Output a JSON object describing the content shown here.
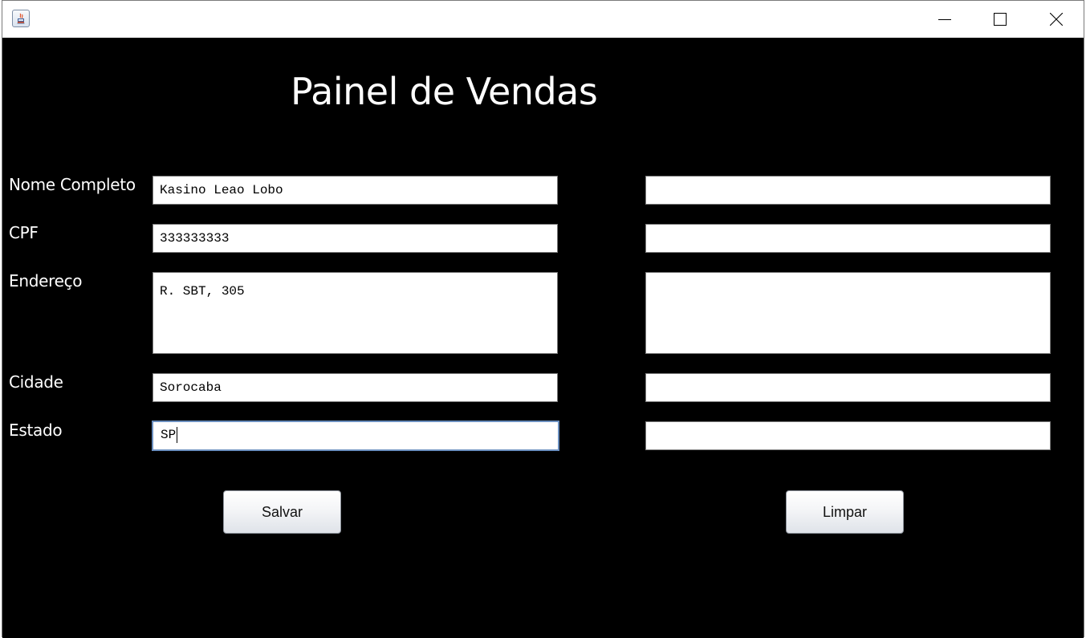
{
  "window": {
    "icon": "java-coffee-icon",
    "controls": [
      "minimize-icon",
      "maximize-icon",
      "close-icon"
    ]
  },
  "form": {
    "title": "Painel de Vendas",
    "labels": {
      "nome": "Nome Completo",
      "cpf": "CPF",
      "endereco": "Endereço",
      "cidade": "Cidade",
      "estado": "Estado"
    },
    "values": {
      "nome": "Kasino Leao Lobo",
      "cpf": "333333333",
      "endereco": "R. SBT, 305",
      "cidade": "Sorocaba",
      "estado": "SP"
    },
    "right_values": {
      "nome": "",
      "cpf": "",
      "endereco": "",
      "cidade": "",
      "estado": ""
    },
    "buttons": {
      "save": "Salvar",
      "clear": "Limpar"
    }
  },
  "colors": {
    "background": "#000000",
    "field": "#ffffff",
    "focus_border": "#6b8fbf"
  }
}
